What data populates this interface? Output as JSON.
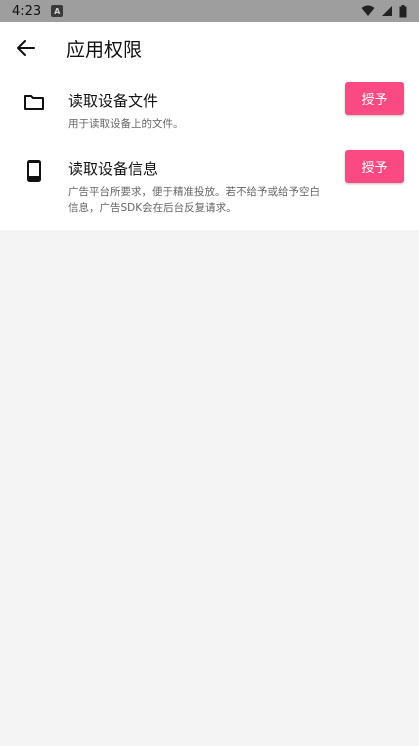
{
  "status_bar": {
    "time": "4:23",
    "notification_letter": "A"
  },
  "app_bar": {
    "title": "应用权限"
  },
  "permissions": [
    {
      "title": "读取设备文件",
      "description": "用于读取设备上的文件。",
      "button": "授予",
      "icon": "folder-icon"
    },
    {
      "title": "读取设备信息",
      "description": "广告平台所要求，便于精准投放。若不给予或给予空白信息，广告SDK会在后台反复请求。",
      "button": "授予",
      "icon": "phone-icon"
    }
  ],
  "colors": {
    "accent": "#fb4a83",
    "status_bar": "#9e9e9e",
    "background": "#f4f4f4"
  }
}
